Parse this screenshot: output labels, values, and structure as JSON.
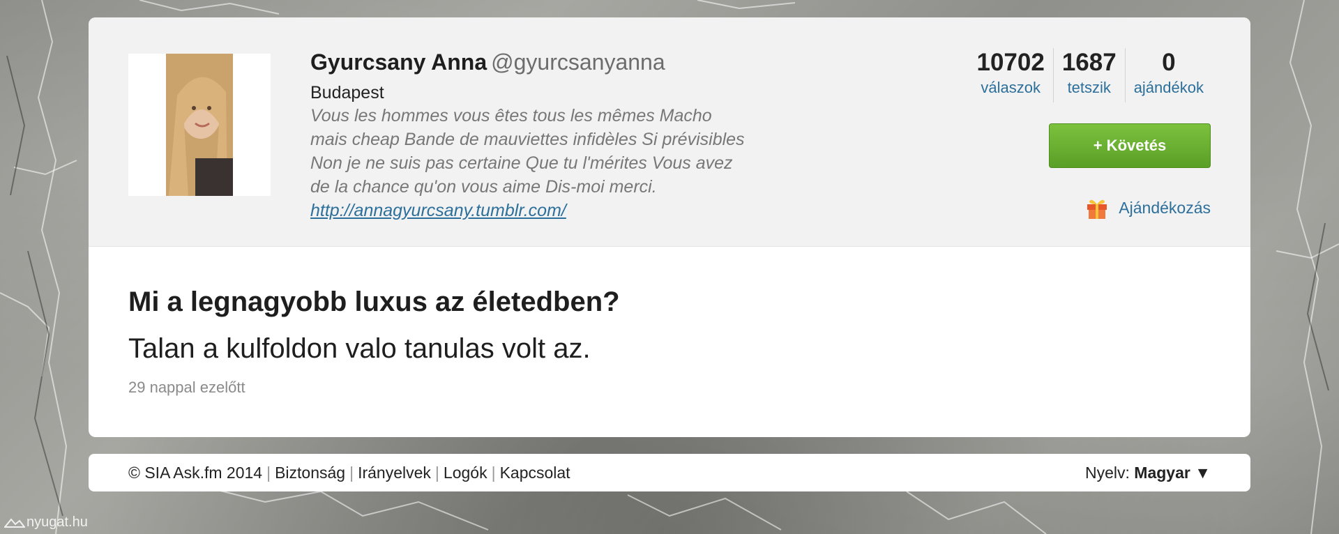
{
  "profile": {
    "name": "Gyurcsany Anna",
    "handle": "@gyurcsanyanna",
    "location": "Budapest",
    "bio_lines": [
      "Vous les hommes vous êtes tous les mêmes Macho",
      "mais cheap Bande de mauviettes infidèles Si prévisibles",
      "Non je ne suis pas certaine Que tu l'mérites Vous avez",
      "de la chance qu'on vous aime Dis-moi merci."
    ],
    "link": "http://annagyurcsany.tumblr.com/"
  },
  "stats": [
    {
      "value": "10702",
      "label": "válaszok"
    },
    {
      "value": "1687",
      "label": "tetszik"
    },
    {
      "value": "0",
      "label": "ajándékok"
    }
  ],
  "actions": {
    "follow_label": "+ Követés",
    "gift_label": "Ajándékozás"
  },
  "post": {
    "question": "Mi a legnagyobb luxus az életedben?",
    "answer": "Talan a kulfoldon valo tanulas volt az.",
    "time": "29 nappal ezelőtt"
  },
  "footer": {
    "copyright": "© SIA Ask.fm 2014",
    "links": [
      "Biztonság",
      "Irányelvek",
      "Logók",
      "Kapcsolat"
    ],
    "language_label": "Nyelv:",
    "language_value": "Magyar ▼"
  },
  "watermark": "nyugat.hu",
  "colors": {
    "link": "#2c6f9b",
    "follow_button": "#6bb22f",
    "card_header_bg": "#f2f2f2"
  }
}
